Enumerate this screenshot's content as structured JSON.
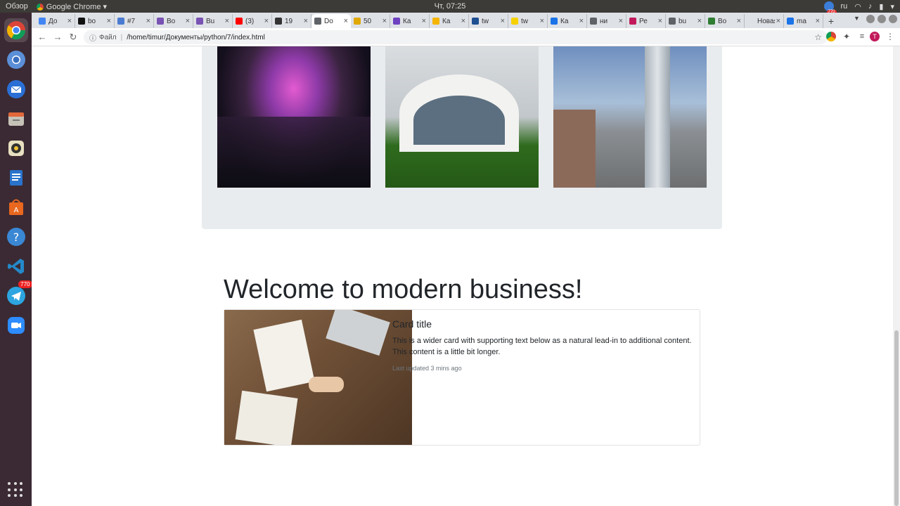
{
  "topbar": {
    "overview": "Обзор",
    "app_name": "Google Chrome",
    "clock": "Чт, 07:25",
    "keyboard_layout": "ru",
    "notification_badge": "770"
  },
  "dock": {
    "telegram_badge": "770"
  },
  "tabs": [
    {
      "label": "До",
      "color": "#4285f4"
    },
    {
      "label": "bo",
      "color": "#111111"
    },
    {
      "label": "#7",
      "color": "#4a7bd1"
    },
    {
      "label": "Bo",
      "color": "#7952b3"
    },
    {
      "label": "Bu",
      "color": "#7952b3"
    },
    {
      "label": "(3)",
      "color": "#ff0000"
    },
    {
      "label": "19",
      "color": "#333333"
    },
    {
      "label": "Do",
      "color": "#5f6368",
      "active": true
    },
    {
      "label": "50",
      "color": "#e0a800"
    },
    {
      "label": "Ка",
      "color": "#6f42c1"
    },
    {
      "label": "Ка",
      "color": "#f4b400"
    },
    {
      "label": "tw",
      "color": "#1d4f91"
    },
    {
      "label": "tw",
      "color": "#f5d100"
    },
    {
      "label": "Ка",
      "color": "#1a73e8"
    },
    {
      "label": "ни",
      "color": "#5f6368"
    },
    {
      "label": "Ре",
      "color": "#c2185b"
    },
    {
      "label": "bu",
      "color": "#5f6368"
    },
    {
      "label": "Во",
      "color": "#2e7d32"
    },
    {
      "label": "Новая",
      "color": "#dee1e6"
    },
    {
      "label": "ma",
      "color": "#1a73e8"
    }
  ],
  "omnibox": {
    "scheme": "Файл",
    "url": "/home/timur/Документы/python/7/index.html"
  },
  "profile_initial": "T",
  "page": {
    "heading": "Welcome to modern business!",
    "card": {
      "title": "Card title",
      "text": "This is a wider card with supporting text below as a natural lead-in to additional content. This content is a little bit longer.",
      "meta": "Last updated 3 mins ago"
    }
  }
}
